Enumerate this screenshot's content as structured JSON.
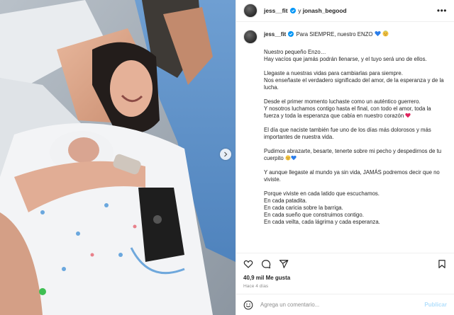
{
  "header": {
    "user1": "jess__fit",
    "conjunction": "y",
    "user2": "jonash_begood"
  },
  "caption": {
    "username": "jess__fit",
    "intro": "Para SIEMPRE, nuestro ENZO",
    "paragraphs": [
      "Nuestro pequeño Enzo…\nHay vacíos que jamás podrán llenarse, y el tuyo será uno de ellos.",
      "Llegaste a nuestras vidas para cambiarlas para siempre.\nNos enseñaste el verdadero significado del amor, de la esperanza y de la lucha.",
      "Desde el primer momento luchaste como un auténtico guerrero.\nY nosotros luchamos contigo hasta el final, con todo el amor, toda la fuerza y toda la esperanza que cabía en nuestro corazón",
      "El día que naciste también fue uno de los días más dolorosos y más importantes de nuestra vida.",
      "Pudimos abrazarte, besarte, tenerte sobre mi pecho y despedirnos de tu cuerpito",
      "Y aunque llegaste al mundo ya sin vida, JAMÁS podremos decir que no viviste.",
      "Porque viviste en cada latido que escuchamos.\nEn cada patadita.\nEn cada caricia sobre la barriga.\nEn cada sueño que construimos contigo.\nEn cada veilta, cada lágrima y cada esperanza."
    ]
  },
  "stats": {
    "likes": "40,9 mil Me gusta",
    "time_ago": "Hace 4 días"
  },
  "comment": {
    "placeholder": "Agrega un comentario...",
    "publish_label": "Publicar"
  },
  "icons": {
    "verified": "verified-badge-icon",
    "more": "more-options-icon",
    "like": "heart-icon",
    "comment": "comment-bubble-icon",
    "share": "paper-plane-icon",
    "save": "bookmark-icon",
    "emoji": "smiley-icon",
    "carousel": "chevron-right-icon"
  },
  "colors": {
    "verified": "#0095f6",
    "publish_disabled": "#b2dffc",
    "border": "#efefef",
    "muted": "#8e8e8e"
  }
}
